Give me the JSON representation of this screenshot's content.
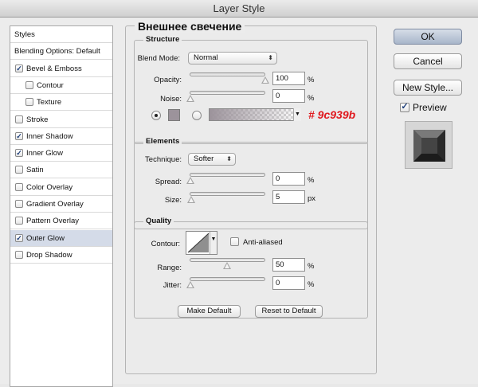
{
  "window_title": "Layer Style",
  "styles_panel": {
    "items": [
      {
        "label": "Styles",
        "type": "header",
        "checked": null,
        "indent": 0,
        "selected": false
      },
      {
        "label": "Blending Options: Default",
        "type": "header",
        "checked": null,
        "indent": 0,
        "selected": false
      },
      {
        "label": "Bevel & Emboss",
        "type": "item",
        "checked": true,
        "indent": 0,
        "selected": false
      },
      {
        "label": "Contour",
        "type": "item",
        "checked": false,
        "indent": 1,
        "selected": false
      },
      {
        "label": "Texture",
        "type": "item",
        "checked": false,
        "indent": 1,
        "selected": false
      },
      {
        "label": "Stroke",
        "type": "item",
        "checked": false,
        "indent": 0,
        "selected": false
      },
      {
        "label": "Inner Shadow",
        "type": "item",
        "checked": true,
        "indent": 0,
        "selected": false
      },
      {
        "label": "Inner Glow",
        "type": "item",
        "checked": true,
        "indent": 0,
        "selected": false
      },
      {
        "label": "Satin",
        "type": "item",
        "checked": false,
        "indent": 0,
        "selected": false
      },
      {
        "label": "Color Overlay",
        "type": "item",
        "checked": false,
        "indent": 0,
        "selected": false
      },
      {
        "label": "Gradient Overlay",
        "type": "item",
        "checked": false,
        "indent": 0,
        "selected": false
      },
      {
        "label": "Pattern Overlay",
        "type": "item",
        "checked": false,
        "indent": 0,
        "selected": false
      },
      {
        "label": "Outer Glow",
        "type": "item",
        "checked": true,
        "indent": 0,
        "selected": true
      },
      {
        "label": "Drop Shadow",
        "type": "item",
        "checked": false,
        "indent": 0,
        "selected": false
      }
    ]
  },
  "panel_title": "Внешнее свечение",
  "structure": {
    "label": "Structure",
    "blend_mode_label": "Blend Mode:",
    "blend_mode_value": "Normal",
    "opacity_label": "Opacity:",
    "opacity_value": "100",
    "opacity_unit": "%",
    "opacity_level": 1.0,
    "noise_label": "Noise:",
    "noise_value": "0",
    "noise_unit": "%",
    "noise_level": 0.0,
    "color_annotation": "# 9c939b",
    "glow_color": "#9c939b",
    "annotation_color": "#e0191e"
  },
  "elements": {
    "label": "Elements",
    "technique_label": "Technique:",
    "technique_value": "Softer",
    "spread_label": "Spread:",
    "spread_value": "0",
    "spread_unit": "%",
    "size_label": "Size:",
    "size_value": "5",
    "size_unit": "px"
  },
  "quality": {
    "label": "Quality",
    "contour_label": "Contour:",
    "anti_aliased_label": "Anti-aliased",
    "anti_aliased_checked": false,
    "range_label": "Range:",
    "range_value": "50",
    "range_unit": "%",
    "range_level": 0.5,
    "jitter_label": "Jitter:",
    "jitter_value": "0",
    "jitter_unit": "%",
    "jitter_level": 0.0
  },
  "buttons": {
    "make_default": "Make Default",
    "reset_default": "Reset to Default",
    "ok": "OK",
    "cancel": "Cancel",
    "new_style": "New Style...",
    "preview_label": "Preview",
    "preview_checked": true
  }
}
